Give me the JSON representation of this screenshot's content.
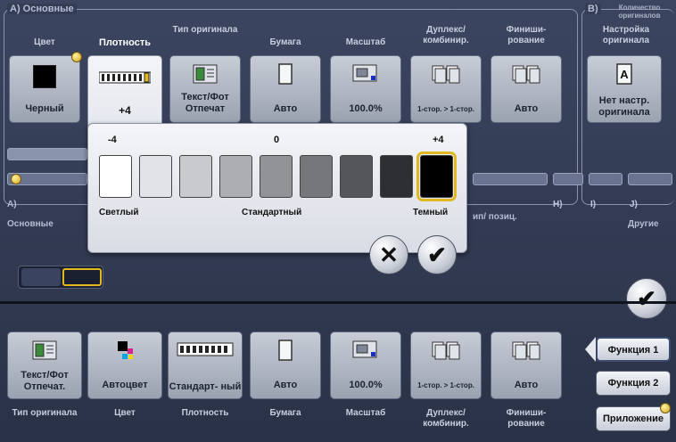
{
  "top": {
    "section_a": "А) Основные",
    "section_b": "В)",
    "section_b_note": "Количество оригиналов",
    "headers": [
      "Цвет",
      "Плотность",
      "Тип оригинала",
      "Бумага",
      "Масштаб",
      "Дуплекс/ комбинир.",
      "Финиши- рование",
      "Настройка оригинала"
    ],
    "tiles": [
      {
        "label": "Черный",
        "icon": "black-square-icon"
      },
      {
        "label": "+4",
        "icon": "density-gauge-icon"
      },
      {
        "label": "Текст/Фот Отпечат",
        "icon": "document-photo-icon"
      },
      {
        "label": "Авто",
        "icon": "paper-icon"
      },
      {
        "label": "100.0%",
        "icon": "zoom-icon"
      },
      {
        "label": "1-стор. > 1-стор.",
        "icon": "duplex-icon"
      },
      {
        "label": "Авто",
        "icon": "finishing-icon"
      },
      {
        "label": "Нет настр. оригинала",
        "icon": "original-a-icon"
      }
    ]
  },
  "strip": {
    "letters": [
      "H)",
      "I)",
      "J)"
    ],
    "left_label": "А)",
    "left_sub": "Основные",
    "other": "Другие",
    "partial": "ип/ позиц."
  },
  "popup": {
    "min": "-4",
    "mid": "0",
    "max": "+4",
    "light": "Светлый",
    "standard": "Стандартный",
    "dark": "Темный",
    "levels": [
      "#ffffff",
      "#e2e3e6",
      "#c9cacd",
      "#adaeb1",
      "#929396",
      "#76777a",
      "#55565a",
      "#2e2f33",
      "#000000"
    ],
    "selected_index": 8
  },
  "bottom": {
    "tiles": [
      {
        "label": "Текст/Фот Отпечат.",
        "caption": "Тип оригинала",
        "icon": "document-photo-icon"
      },
      {
        "label": "Автоцвет",
        "caption": "Цвет",
        "icon": "auto-color-icon"
      },
      {
        "label": "Стандарт- ный",
        "caption": "Плотность",
        "icon": "density-gauge-icon"
      },
      {
        "label": "Авто",
        "caption": "Бумага",
        "icon": "paper-icon"
      },
      {
        "label": "100.0%",
        "caption": "Масштаб",
        "icon": "zoom-icon"
      },
      {
        "label": "1-стор. > 1-стор.",
        "caption": "Дуплекс/ комбинир.",
        "icon": "duplex-icon"
      },
      {
        "label": "Авто",
        "caption": "Финиши- рование",
        "icon": "finishing-icon"
      }
    ]
  },
  "side": {
    "func1": "Функция 1",
    "func2": "Функция 2",
    "app": "Приложение"
  },
  "buttons": {
    "cancel": "✕",
    "ok": "✔"
  }
}
